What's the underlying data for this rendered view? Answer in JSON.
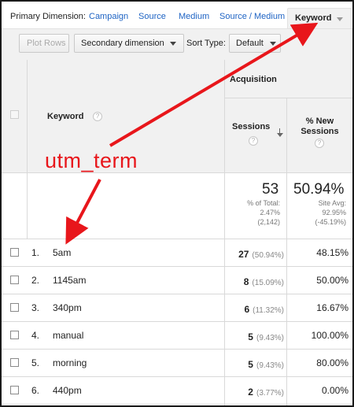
{
  "dimension_bar": {
    "label": "Primary Dimension:",
    "links": [
      "Campaign",
      "Source",
      "Medium",
      "Source / Medium"
    ],
    "active": "Keyword"
  },
  "toolbar": {
    "plot_rows": "Plot Rows",
    "secondary_dimension": "Secondary dimension",
    "sort_type_label": "Sort Type:",
    "sort_type_value": "Default"
  },
  "table": {
    "group_header": "Acquisition",
    "col_keyword": "Keyword",
    "col_sessions": "Sessions",
    "col_new_sessions": "% New Sessions",
    "help_glyph": "?",
    "totals": {
      "sessions": "53",
      "sessions_sub1": "% of Total:",
      "sessions_sub2": "2.47%",
      "sessions_sub3": "(2,142)",
      "new_sessions": "50.94%",
      "new_sessions_sub1": "Site Avg:",
      "new_sessions_sub2": "92.95%",
      "new_sessions_sub3": "(-45.19%)"
    },
    "rows": [
      {
        "num": "1.",
        "keyword": "5am",
        "sessions": "27",
        "sessions_pct": "(50.94%)",
        "new_sessions": "48.15%"
      },
      {
        "num": "2.",
        "keyword": "1145am",
        "sessions": "8",
        "sessions_pct": "(15.09%)",
        "new_sessions": "50.00%"
      },
      {
        "num": "3.",
        "keyword": "340pm",
        "sessions": "6",
        "sessions_pct": "(11.32%)",
        "new_sessions": "16.67%"
      },
      {
        "num": "4.",
        "keyword": "manual",
        "sessions": "5",
        "sessions_pct": "(9.43%)",
        "new_sessions": "100.00%"
      },
      {
        "num": "5.",
        "keyword": "morning",
        "sessions": "5",
        "sessions_pct": "(9.43%)",
        "new_sessions": "80.00%"
      },
      {
        "num": "6.",
        "keyword": "440pm",
        "sessions": "2",
        "sessions_pct": "(3.77%)",
        "new_sessions": "0.00%"
      }
    ]
  },
  "annotation": {
    "text": "utm_term",
    "color": "#e8161b"
  },
  "colors": {
    "link": "#1f64c4",
    "header_bg": "#f1f1f1",
    "border": "#d9d9d9"
  }
}
